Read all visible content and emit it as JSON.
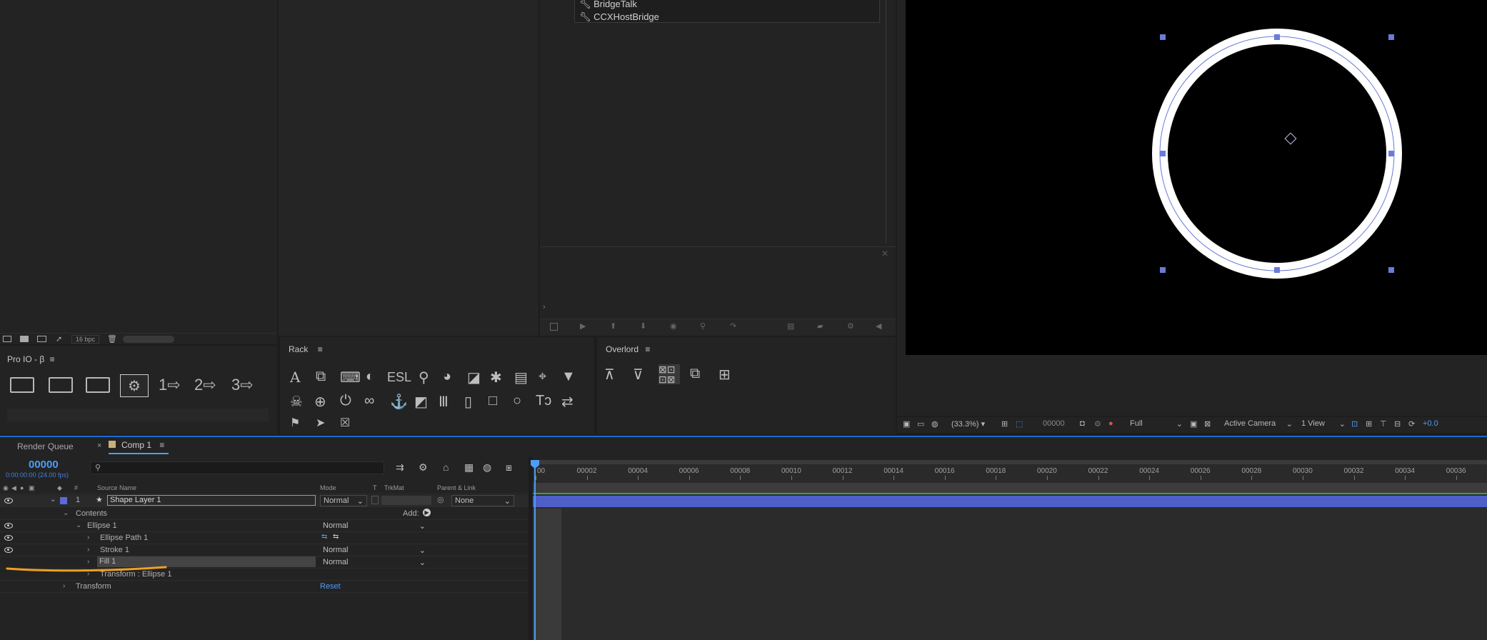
{
  "script_list": {
    "items": [
      "BridgeTalk",
      "CCXHostBridge"
    ]
  },
  "project_footer": {
    "bpc": "16 bpc"
  },
  "pro_io": {
    "title": "Pro IO - β",
    "icons": [
      "new-folder-icon",
      "refresh-folder-icon",
      "no-folder-icon",
      "gear-icon",
      "preset-1-icon",
      "preset-2-icon",
      "preset-3-icon"
    ]
  },
  "rack": {
    "title": "Rack",
    "row1": [
      "text-icon",
      "copy-icon",
      "keyboard-icon",
      "contrast-icon",
      "esl-icon",
      "pin-icon",
      "palette-icon",
      "note-icon",
      "bug-icon",
      "clipboard-icon",
      "map-pin-icon",
      "filter-icon"
    ],
    "row2": [
      "skull-icon",
      "crosshair-icon",
      "power-icon",
      "link-icon",
      "anchor-icon",
      "swatch-icon",
      "bars-icon",
      "file-icon",
      "square-icon",
      "circle-icon",
      "text-size-icon",
      "swap-icon"
    ],
    "row3": [
      "flag-icon",
      "cursor-icon",
      "skull-box-icon"
    ],
    "esl_text": "ESL"
  },
  "overlord": {
    "title": "Overlord"
  },
  "viewer": {
    "zoom": "(33.3%)",
    "timecode": "00000",
    "resolution": "Full",
    "camera": "Active Camera",
    "view": "1 View",
    "exposure": "+0.0"
  },
  "tabs": {
    "render_queue": "Render Queue",
    "comp": "Comp 1"
  },
  "timeline": {
    "current_time": "00000",
    "time_sub": "0:00:00:00 (24.00 fps)",
    "search_placeholder": "",
    "headers": {
      "num": "#",
      "source_name": "Source Name",
      "mode": "Mode",
      "t": "T",
      "trkmat": "TrkMat",
      "parent": "Parent & Link"
    },
    "ruler": [
      "00",
      "00002",
      "00004",
      "00006",
      "00008",
      "00010",
      "00012",
      "00014",
      "00016",
      "00018",
      "00020",
      "00022",
      "00024",
      "00026",
      "00028",
      "00030",
      "00032",
      "00034",
      "00036"
    ],
    "layer": {
      "index": "1",
      "name": "Shape Layer 1",
      "mode": "Normal",
      "parent": "None"
    },
    "contents_label": "Contents",
    "add_label": "Add:",
    "ellipse": {
      "label": "Ellipse 1",
      "mode": "Normal"
    },
    "ellipse_path": {
      "label": "Ellipse Path 1"
    },
    "stroke": {
      "label": "Stroke 1",
      "mode": "Normal"
    },
    "fill": {
      "label": "Fill 1",
      "mode": "Normal"
    },
    "transform_ellipse": {
      "label": "Transform : Ellipse 1"
    },
    "transform": {
      "label": "Transform",
      "reset": "Reset"
    }
  },
  "colors": {
    "accent_blue": "#4a9ef5",
    "layer_bar": "#4f5fc8",
    "annotation": "#f0a020",
    "label_swatch": "#5a6ad8"
  }
}
